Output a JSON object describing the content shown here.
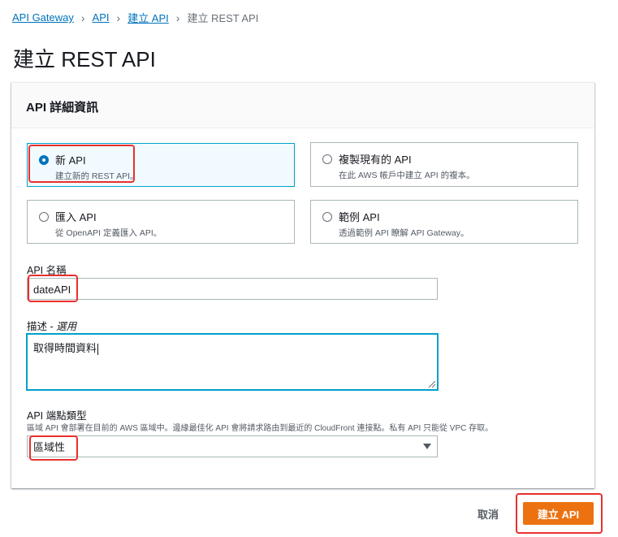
{
  "breadcrumb": {
    "items": [
      "API Gateway",
      "API",
      "建立 API"
    ],
    "current": "建立 REST API"
  },
  "page": {
    "title": "建立 REST API"
  },
  "panel": {
    "header": "API 詳細資訊",
    "options": [
      {
        "title": "新 API",
        "desc": "建立新的 REST API。",
        "selected": true
      },
      {
        "title": "複製現有的 API",
        "desc": "在此 AWS 帳戶中建立 API 的複本。",
        "selected": false
      },
      {
        "title": "匯入 API",
        "desc": "從 OpenAPI 定義匯入 API。",
        "selected": false
      },
      {
        "title": "範例 API",
        "desc": "透過範例 API 瞭解 API Gateway。",
        "selected": false
      }
    ],
    "name_label": "API 名稱",
    "name_value": "dateAPI",
    "desc_label": "描述 - ",
    "desc_optional": "選用",
    "desc_value": "取得時間資料",
    "endpoint_label": "API 端點類型",
    "endpoint_hint": "區域 API 會部署在目前的 AWS 區域中。邊緣最佳化 API 會將請求路由到最近的 CloudFront 連接點。私有 API 只能從 VPC 存取。",
    "endpoint_value": "區域性"
  },
  "actions": {
    "cancel": "取消",
    "create": "建立 API"
  },
  "colors": {
    "link": "#0073bb",
    "primary": "#ec7211",
    "selected_border": "#00a1c9",
    "highlight": "#e8302d"
  }
}
